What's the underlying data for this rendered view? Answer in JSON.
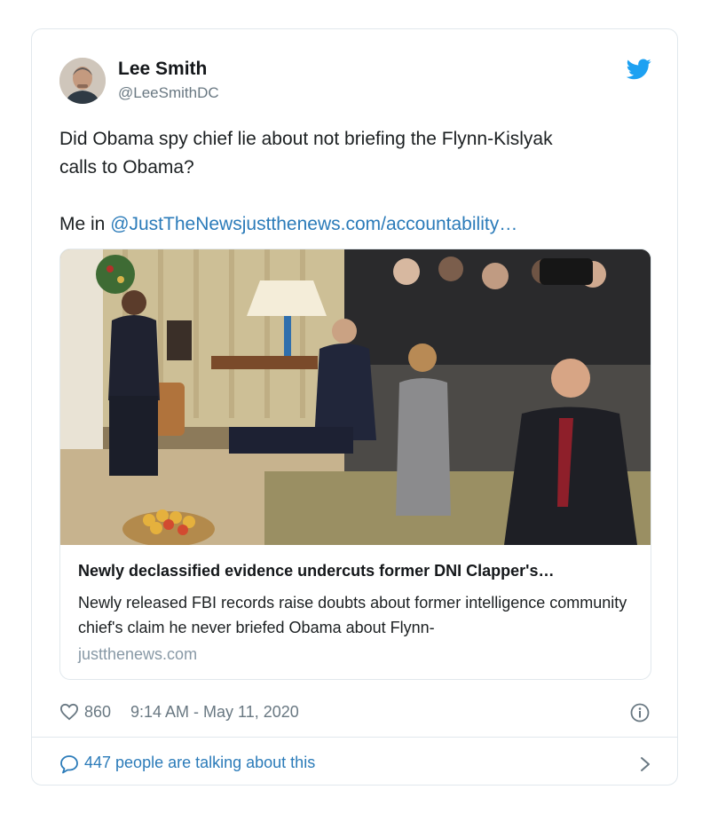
{
  "author": {
    "name": "Lee Smith",
    "handle": "@LeeSmithDC",
    "avatar_icon": "user-avatar"
  },
  "tweet": {
    "line1": "Did Obama spy chief lie about not briefing the Flynn-Kislyak",
    "line2": "calls to Obama?",
    "prefix": "Me in ",
    "mention": "@JustTheNews",
    "url": "justthenews.com/accountability…"
  },
  "card": {
    "title": "Newly declassified evidence undercuts former DNI Clapper's…",
    "description": "Newly released FBI records raise doubts about former intelligence community chief's claim he never briefed Obama about Flynn-",
    "domain": "justthenews.com",
    "image_icon": "oval-office-photo"
  },
  "meta": {
    "likes": "860",
    "timestamp": "9:14 AM - May 11, 2020"
  },
  "conversation": {
    "label": "447 people are talking about this"
  },
  "colors": {
    "link": "#2b7bb9",
    "twitter_blue": "#1da1f2",
    "muted": "#697882",
    "border": "#e1e8ed"
  }
}
